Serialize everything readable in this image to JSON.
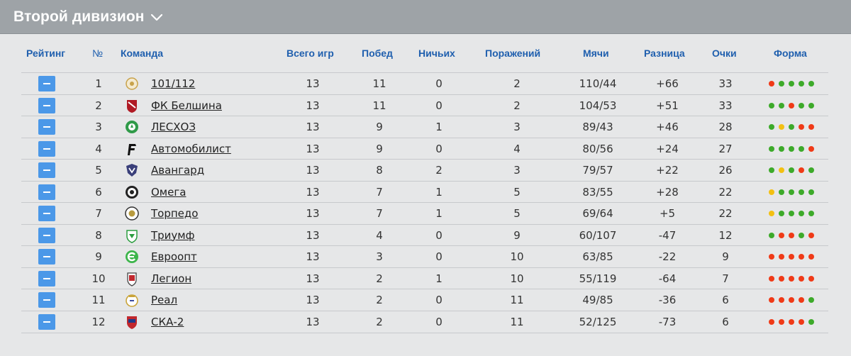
{
  "title": "Второй дивизион",
  "headers": {
    "rating": "Рейтинг",
    "num": "№",
    "team": "Команда",
    "games": "Всего игр",
    "wins": "Побед",
    "draws": "Ничьих",
    "losses": "Поражений",
    "goals": "Мячи",
    "diff": "Разница",
    "points": "Очки",
    "form": "Форма"
  },
  "colors": {
    "W": "#3daa2a",
    "L": "#f03a17",
    "D": "#f3c012"
  },
  "rows": [
    {
      "num": "1",
      "team": "101/112",
      "logo": "crest-101-icon",
      "games": "13",
      "wins": "11",
      "draws": "0",
      "losses": "2",
      "goals": "110/44",
      "diff": "+66",
      "points": "33",
      "form": [
        "L",
        "W",
        "W",
        "W",
        "W"
      ]
    },
    {
      "num": "2",
      "team": "ФК Белшина",
      "logo": "crest-belshina-icon",
      "games": "13",
      "wins": "11",
      "draws": "0",
      "losses": "2",
      "goals": "104/53",
      "diff": "+51",
      "points": "33",
      "form": [
        "W",
        "W",
        "L",
        "W",
        "W"
      ]
    },
    {
      "num": "3",
      "team": "ЛЕСХОЗ",
      "logo": "crest-leskhoz-icon",
      "games": "13",
      "wins": "9",
      "draws": "1",
      "losses": "3",
      "goals": "89/43",
      "diff": "+46",
      "points": "28",
      "form": [
        "W",
        "D",
        "W",
        "L",
        "L"
      ]
    },
    {
      "num": "4",
      "team": "Автомобилист",
      "logo": "crest-avto-icon",
      "games": "13",
      "wins": "9",
      "draws": "0",
      "losses": "4",
      "goals": "80/56",
      "diff": "+24",
      "points": "27",
      "form": [
        "W",
        "W",
        "W",
        "W",
        "L"
      ]
    },
    {
      "num": "5",
      "team": "Авангард",
      "logo": "crest-avangard-icon",
      "games": "13",
      "wins": "8",
      "draws": "2",
      "losses": "3",
      "goals": "79/57",
      "diff": "+22",
      "points": "26",
      "form": [
        "W",
        "D",
        "W",
        "L",
        "W"
      ]
    },
    {
      "num": "6",
      "team": "Омега",
      "logo": "crest-omega-icon",
      "games": "13",
      "wins": "7",
      "draws": "1",
      "losses": "5",
      "goals": "83/55",
      "diff": "+28",
      "points": "22",
      "form": [
        "D",
        "W",
        "W",
        "W",
        "W"
      ]
    },
    {
      "num": "7",
      "team": "Торпедо",
      "logo": "crest-torpedo-icon",
      "games": "13",
      "wins": "7",
      "draws": "1",
      "losses": "5",
      "goals": "69/64",
      "diff": "+5",
      "points": "22",
      "form": [
        "D",
        "W",
        "W",
        "W",
        "W"
      ]
    },
    {
      "num": "8",
      "team": "Триумф",
      "logo": "crest-triumf-icon",
      "games": "13",
      "wins": "4",
      "draws": "0",
      "losses": "9",
      "goals": "60/107",
      "diff": "-47",
      "points": "12",
      "form": [
        "W",
        "L",
        "L",
        "W",
        "L"
      ]
    },
    {
      "num": "9",
      "team": "Евроопт",
      "logo": "crest-evroopt-icon",
      "games": "13",
      "wins": "3",
      "draws": "0",
      "losses": "10",
      "goals": "63/85",
      "diff": "-22",
      "points": "9",
      "form": [
        "L",
        "L",
        "L",
        "L",
        "L"
      ]
    },
    {
      "num": "10",
      "team": "Легион",
      "logo": "crest-legion-icon",
      "games": "13",
      "wins": "2",
      "draws": "1",
      "losses": "10",
      "goals": "55/119",
      "diff": "-64",
      "points": "7",
      "form": [
        "L",
        "L",
        "L",
        "L",
        "L"
      ]
    },
    {
      "num": "11",
      "team": "Реал",
      "logo": "crest-real-icon",
      "games": "13",
      "wins": "2",
      "draws": "0",
      "losses": "11",
      "goals": "49/85",
      "diff": "-36",
      "points": "6",
      "form": [
        "L",
        "L",
        "L",
        "L",
        "W"
      ]
    },
    {
      "num": "12",
      "team": "СКА-2",
      "logo": "crest-ska-icon",
      "games": "13",
      "wins": "2",
      "draws": "0",
      "losses": "11",
      "goals": "52/125",
      "diff": "-73",
      "points": "6",
      "form": [
        "L",
        "L",
        "L",
        "L",
        "W"
      ]
    }
  ]
}
